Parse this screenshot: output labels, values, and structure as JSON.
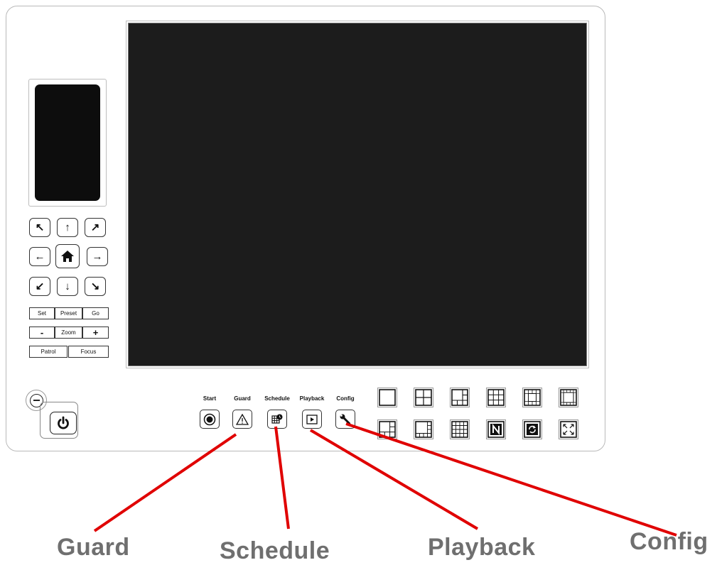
{
  "ptz": {
    "set": "Set",
    "preset": "Preset",
    "go": "Go",
    "zoom_out": "-",
    "zoom": "Zoom",
    "zoom_in": "+",
    "patrol": "Patrol",
    "focus": "Focus"
  },
  "toolbar": {
    "start": "Start",
    "guard": "Guard",
    "schedule": "Schedule",
    "playback": "Playback",
    "config": "Config"
  },
  "callouts": {
    "guard": "Guard",
    "schedule": "Schedule",
    "playback": "Playback",
    "config": "Config"
  },
  "layout_buttons": {
    "row1": [
      "single-view-icon",
      "quad-view-icon",
      "one-plus-three-view-icon",
      "nine-view-icon",
      "one-plus-twelve-view-icon",
      "one-plus-sixteen-view-icon"
    ],
    "row2": [
      "one-plus-five-view-icon",
      "one-plus-seven-view-icon",
      "sixteen-view-icon",
      "n-view-icon",
      "rotate-view-icon",
      "fullscreen-icon"
    ]
  },
  "colors": {
    "callout_line": "#e00000",
    "screen": "#1c1c1c",
    "callout_text": "#6f6f6f"
  }
}
